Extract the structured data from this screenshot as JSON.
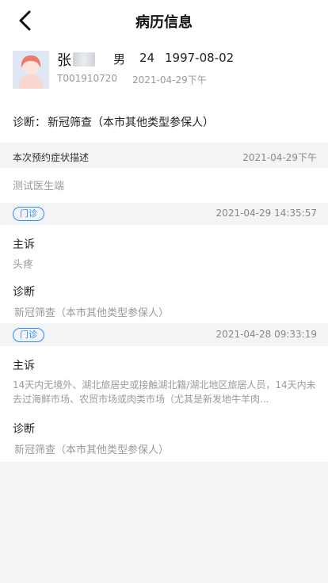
{
  "header": {
    "title": "病历信息",
    "back_icon": "chevron-left-icon"
  },
  "patient": {
    "name": "张",
    "gender": "男",
    "age": "24",
    "birthdate": "1997-08-02",
    "id": "T001910720",
    "date": "2021-04-29下午",
    "avatar_icon": "person-avatar-icon"
  },
  "diagnosis_summary": {
    "label": "诊断：",
    "value": "新冠筛查（本市其他类型参保人）"
  },
  "symptom_section": {
    "label": "本次预约症状描述",
    "date": "2021-04-29下午",
    "content": "测试医生端"
  },
  "records": [
    {
      "badge": "门诊",
      "datetime": "2021-04-29 14:35:57",
      "complaint_label": "主诉",
      "complaint": "头疼",
      "diagnosis_label": "诊断",
      "diagnosis": "新冠筛查（本市其他类型参保人）"
    },
    {
      "badge": "门诊",
      "datetime": "2021-04-28 09:33:19",
      "complaint_label": "主诉",
      "complaint": "14天内无境外、湖北旅居史或接触湖北籍/湖北地区旅居人员，14天内未去过海鲜市场、农贸市场或肉类市场（尤其是新发地牛羊肉...",
      "diagnosis_label": "诊断",
      "diagnosis": "新冠筛查（本市其他类型参保人）"
    }
  ],
  "colors": {
    "accent": "#2e8cf0",
    "background": "#f4f5f7",
    "muted_text": "#9a9a9a"
  }
}
